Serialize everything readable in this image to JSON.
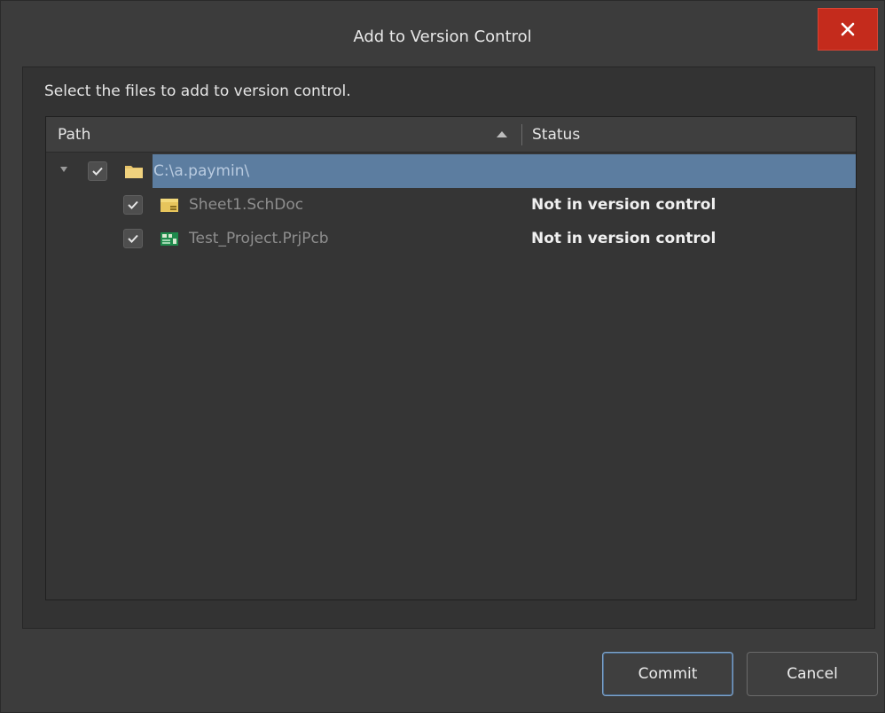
{
  "dialog": {
    "title": "Add to Version Control",
    "instruction": "Select the files to add to version control.",
    "close_label": "✕"
  },
  "columns": {
    "path": "Path",
    "status": "Status"
  },
  "tree": {
    "root": {
      "name": "C:\\a.paymin\\",
      "checked": true,
      "expanded": true,
      "selected": true
    },
    "items": [
      {
        "name": "Sheet1.SchDoc",
        "status": "Not in version control",
        "checked": true,
        "icon": "schematic-doc-icon"
      },
      {
        "name": "Test_Project.PrjPcb",
        "status": "Not in version control",
        "checked": true,
        "icon": "pcb-project-icon"
      }
    ]
  },
  "buttons": {
    "commit": "Commit",
    "cancel": "Cancel"
  },
  "colors": {
    "selection": "#5c7da0",
    "close": "#c42b1c",
    "background": "#3c3c3c"
  }
}
